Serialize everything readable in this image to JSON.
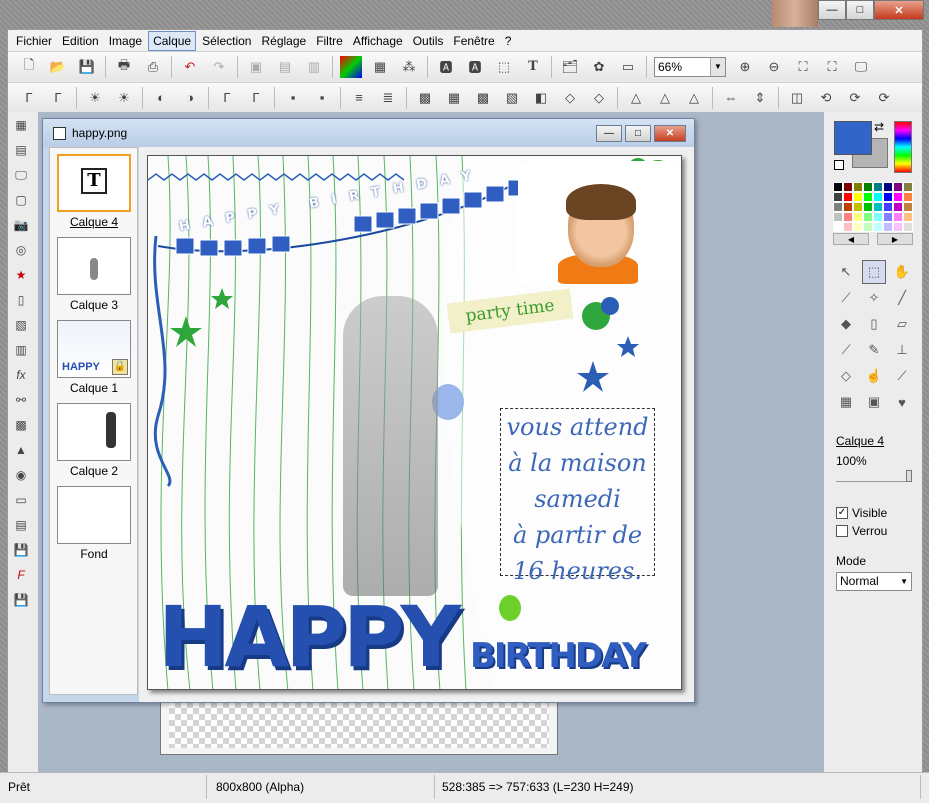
{
  "menu": [
    "Fichier",
    "Edition",
    "Image",
    "Calque",
    "Sélection",
    "Réglage",
    "Filtre",
    "Affichage",
    "Outils",
    "Fenêtre",
    "?"
  ],
  "menu_active": "Calque",
  "zoom": "66%",
  "document": {
    "title": "happy.png",
    "layers": [
      {
        "name": "Calque 4",
        "selected": true
      },
      {
        "name": "Calque 3",
        "selected": false
      },
      {
        "name": "Calque 1",
        "selected": false
      },
      {
        "name": "Calque 2",
        "selected": false
      },
      {
        "name": "Fond",
        "selected": false
      }
    ]
  },
  "image_text": {
    "banner": "HAPPY BIRTHDAY",
    "tag": "party time",
    "lines": [
      "vous attend",
      "à la maison",
      "samedi",
      "à partir de",
      "16 heures."
    ],
    "big_word_1": "HAPPY",
    "big_word_2": "BIRTHDAY"
  },
  "right_panel": {
    "layer_name": "Calque 4",
    "opacity": "100%",
    "opacity_value": 1.0,
    "visible_label": "Visible",
    "visible_checked": true,
    "lock_label": "Verrou",
    "lock_checked": false,
    "mode_label": "Mode",
    "mode_value": "Normal",
    "primary_color": "#3265c8",
    "secondary_color": "#b4b4b4"
  },
  "status": {
    "state": "Prêt",
    "size": "800x800 (Alpha)",
    "selection": "528:385 => 757:633 (L=230  H=249)"
  },
  "window_controls": {
    "minimize": "—",
    "maximize": "□",
    "close": "✕"
  }
}
